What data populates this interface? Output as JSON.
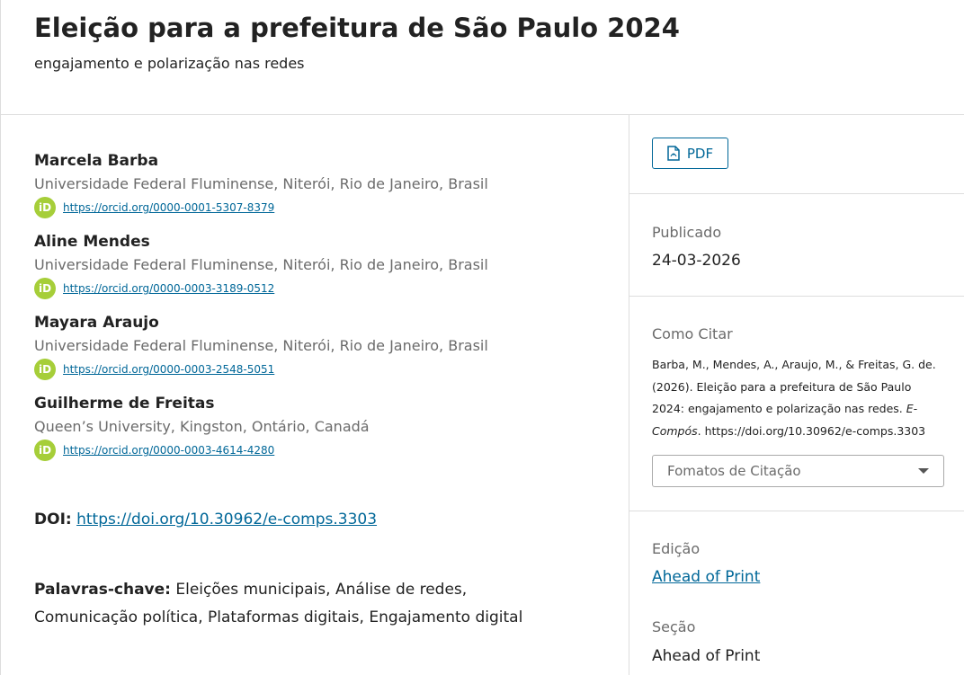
{
  "article": {
    "title": "Eleição para a prefeitura de São Paulo 2024",
    "subtitle": "engajamento e polarização nas redes"
  },
  "authors": [
    {
      "name": "Marcela Barba",
      "affiliation": "Universidade Federal Fluminense, Niterói, Rio de Janeiro, Brasil",
      "orcid": "https://orcid.org/0000-0001-5307-8379"
    },
    {
      "name": "Aline Mendes",
      "affiliation": "Universidade Federal Fluminense, Niterói, Rio de Janeiro, Brasil",
      "orcid": "https://orcid.org/0000-0003-3189-0512"
    },
    {
      "name": "Mayara Araujo",
      "affiliation": "Universidade Federal Fluminense, Niterói, Rio de Janeiro, Brasil",
      "orcid": "https://orcid.org/0000-0003-2548-5051"
    },
    {
      "name": "Guilherme de Freitas",
      "affiliation": "Queen’s University, Kingston, Ontário, Canadá",
      "orcid": "https://orcid.org/0000-0003-4614-4280"
    }
  ],
  "orcid_icon_text": "iD",
  "doi": {
    "label": "DOI:",
    "url": "https://doi.org/10.30962/e-comps.3303"
  },
  "keywords": {
    "label": "Palavras-chave:",
    "value": "Eleições municipais, Análise de redes, Comunicação política, Plataformas digitais, Engajamento digital"
  },
  "sidebar": {
    "pdf_label": "PDF",
    "published_label": "Publicado",
    "published_value": "24-03-2026",
    "cite_label": "Como Citar",
    "citation_before": "Barba, M., Mendes, A., Araujo, M., & Freitas, G. de. (2026). Eleição para a prefeitura de São Paulo 2024: engajamento e polarização nas redes. ",
    "citation_journal": "E-Compós",
    "citation_after": ". https://doi.org/10.30962/e-comps.3303",
    "citation_formats_label": "Fomatos de Citação",
    "issue_label": "Edição",
    "issue_value": "Ahead of Print",
    "section_label": "Seção",
    "section_value": "Ahead of Print"
  },
  "colors": {
    "link": "#006798",
    "orcid": "#a6ce39",
    "muted": "#6b6b6b",
    "border": "#dddddd"
  },
  "icons": {
    "pdf": "pdf-file-icon",
    "orcid": "orcid-icon",
    "dropdown": "chevron-down-icon"
  }
}
